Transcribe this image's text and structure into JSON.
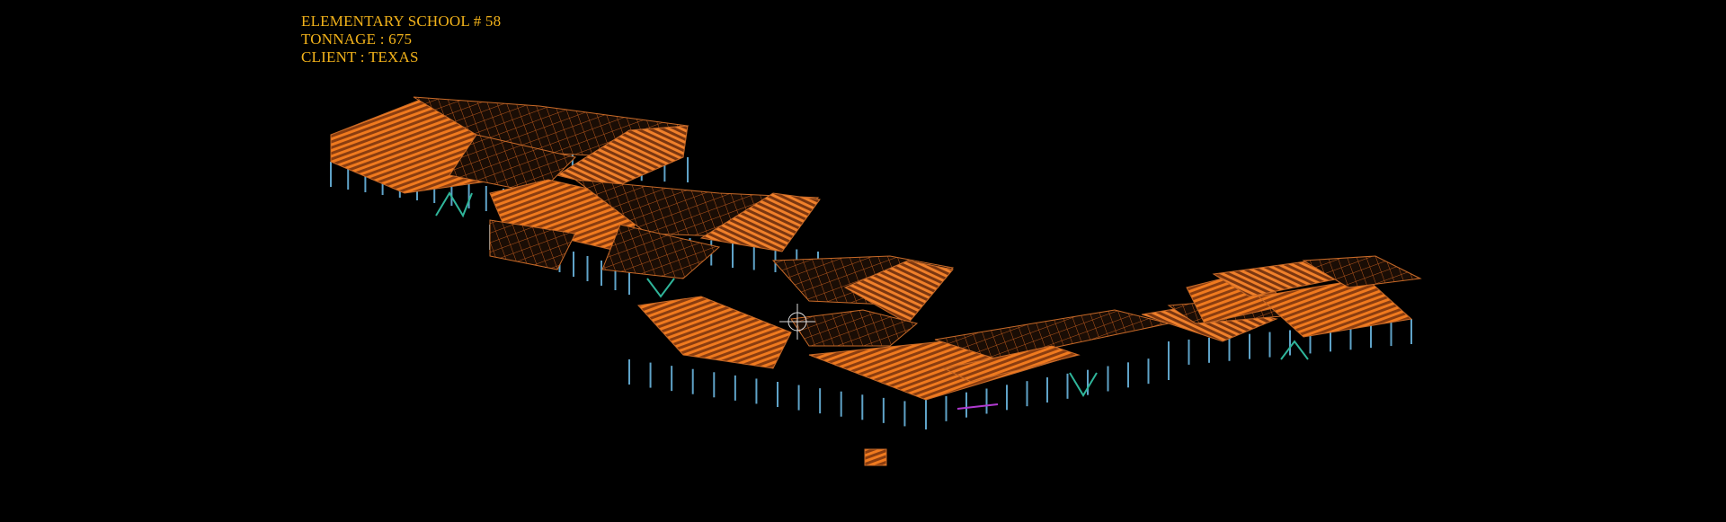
{
  "project": {
    "line1": "ELEMENTARY SCHOOL # 58",
    "line2": "TONNAGE : 675",
    "line3": "CLIENT : TEXAS"
  },
  "colors": {
    "background": "#000000",
    "label": "#f2b21a",
    "joist": "#f07a1e",
    "beam": "#c86a28",
    "column": "#5fa3c8",
    "brace": "#2fb59a",
    "accent": "#b03ad0"
  },
  "viewport": {
    "view": "3D isometric steel structure model",
    "cursor_icon": "crosshair-cursor-icon"
  }
}
